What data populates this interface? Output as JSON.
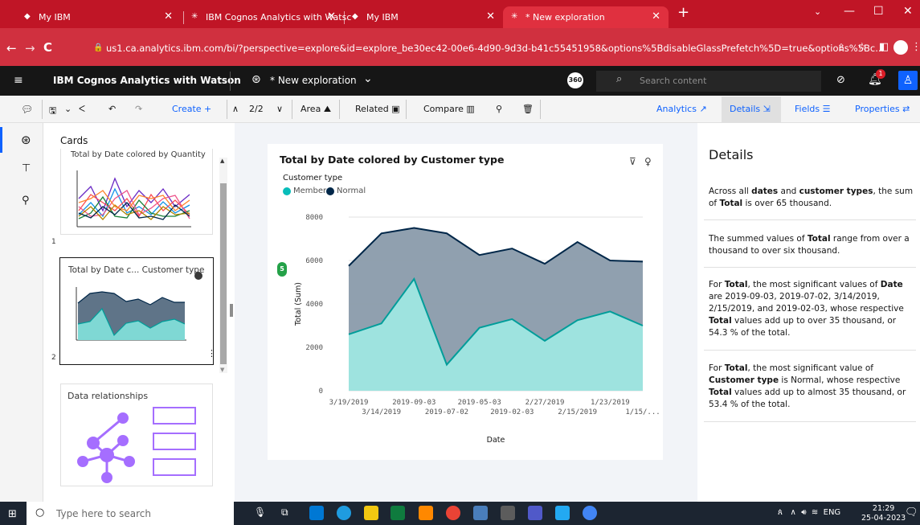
{
  "browser": {
    "tabs": [
      {
        "title": "My IBM"
      },
      {
        "title": "IBM Cognos Analytics with Watsc"
      },
      {
        "title": "My IBM"
      },
      {
        "title": "* New exploration"
      }
    ],
    "url": "us1.ca.analytics.ibm.com/bi/?perspective=explore&id=explore_be30ec42-00e6-4d90-9d3d-b41c55451958&options%5BdisableGlassPrefetch%5D=true&options%5Bc..."
  },
  "app": {
    "name": "IBM Cognos Analytics with Watson",
    "exploration": "* New exploration",
    "search_placeholder": "Search content",
    "notification_count": "1",
    "badge_360": "360"
  },
  "toolbar": {
    "create": "Create +",
    "page": "2/2",
    "area": "Area",
    "related": "Related",
    "compare": "Compare",
    "analytics": "Analytics",
    "details": "Details",
    "fields": "Fields",
    "properties": "Properties"
  },
  "cards": {
    "title": "Cards",
    "card1_title": "Total by Date colored by Quantity",
    "card1_number": "1",
    "card2_title": "Total by Date c... Customer type",
    "card2_number": "2",
    "card3_title": "Data relationships"
  },
  "chart_data": {
    "type": "area",
    "title": "Total by Date colored by Customer type",
    "legend_title": "Customer type",
    "xlabel": "Date",
    "ylabel": "Total (Sum)",
    "ylim": [
      0,
      8000
    ],
    "yticks": [
      "0",
      "2000",
      "4000",
      "6000",
      "8000"
    ],
    "categories": [
      "3/19/2019",
      "3/14/2019",
      "2019-09-03",
      "2019-07-02",
      "2019-05-03",
      "2019-02-03",
      "2/27/2019",
      "2/15/2019",
      "1/23/2019",
      "1/15/..."
    ],
    "series": [
      {
        "name": "Member",
        "color": "#08bdba",
        "values": [
          2600,
          3100,
          5150,
          1200,
          2900,
          3300,
          2300,
          3250,
          3650,
          3000
        ]
      },
      {
        "name": "Normal",
        "color": "#012749",
        "values": [
          3150,
          4150,
          2350,
          6050,
          3350,
          3250,
          3550,
          3600,
          2350,
          2950
        ]
      }
    ],
    "stacked": true,
    "badge": "5"
  },
  "details": {
    "title": "Details",
    "p1": "Across all dates and customer types, the sum of Total is over 65 thousand.",
    "p2": "The summed values of Total range from over a thousand to over six thousand.",
    "p3": "For Total, the most significant values of Date are 2019-09-03, 2019-07-02, 3/14/2019, 2/15/2019, and 2019-02-03, whose respective Total values add up to over 35 thousand, or 54.3 % of the total.",
    "p4": "For Total, the most significant value of Customer type is Normal, whose respective Total values add up to almost 35 thousand, or 53.4 % of the total."
  },
  "taskbar": {
    "search_placeholder": "Type here to search",
    "lang": "ENG",
    "time": "21:29",
    "date": "25-04-2023"
  }
}
